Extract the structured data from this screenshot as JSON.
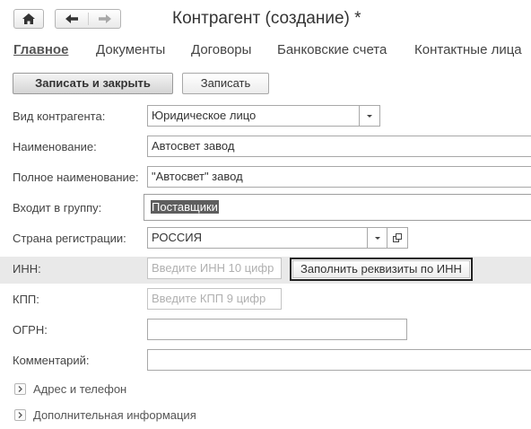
{
  "window": {
    "title": "Контрагент (создание) *"
  },
  "nav": {
    "home_icon": "home-icon",
    "back_icon": "arrow-left-icon",
    "forward_icon": "arrow-right-icon"
  },
  "tabs": [
    {
      "label": "Главное",
      "active": true
    },
    {
      "label": "Документы",
      "active": false
    },
    {
      "label": "Договоры",
      "active": false
    },
    {
      "label": "Банковские счета",
      "active": false
    },
    {
      "label": "Контактные лица",
      "active": false
    }
  ],
  "commands": {
    "save_close": "Записать и закрыть",
    "save": "Записать"
  },
  "form": {
    "kind": {
      "label": "Вид контрагента:",
      "value": "Юридическое лицо"
    },
    "name": {
      "label": "Наименование:",
      "value": "Автосвет завод"
    },
    "full_name": {
      "label": "Полное наименование:",
      "value": "\"Автосвет\" завод"
    },
    "group": {
      "label": "Входит в группу:",
      "value": "Поставщики"
    },
    "country": {
      "label": "Страна регистрации:",
      "value": "РОССИЯ"
    },
    "inn": {
      "label": "ИНН:",
      "placeholder": "Введите ИНН 10 цифр"
    },
    "fill_button": "Заполнить реквизиты по ИНН",
    "kpp": {
      "label": "КПП:",
      "placeholder": "Введите КПП 9 цифр"
    },
    "ogrn": {
      "label": "ОГРН:",
      "value": ""
    },
    "comment": {
      "label": "Комментарий:",
      "value": ""
    }
  },
  "sections": {
    "address": "Адрес и телефон",
    "additional": "Дополнительная информация"
  },
  "colors": {
    "inn_row_highlight": "#e9e9e9",
    "selected_text_bg": "#5e5e5e"
  }
}
